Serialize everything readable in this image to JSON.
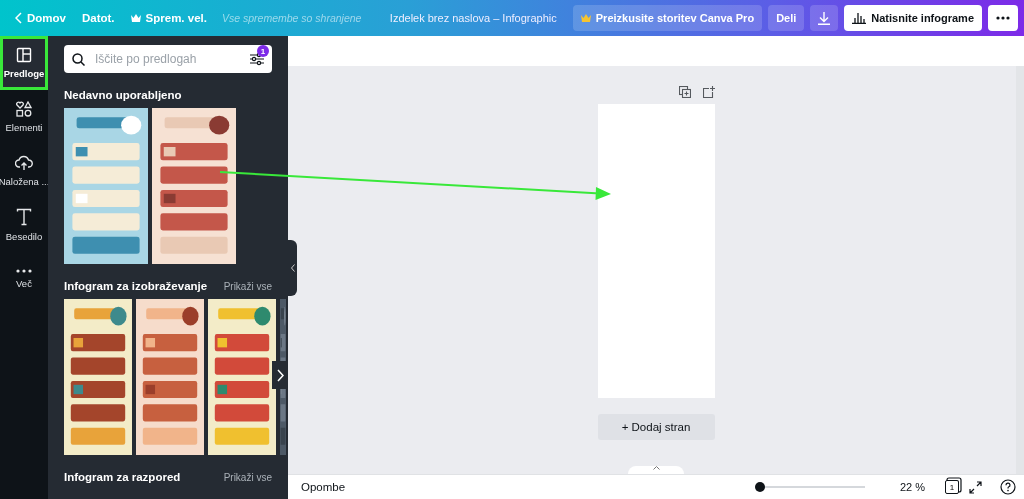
{
  "topbar": {
    "home": "Domov",
    "file": "Datot.",
    "resize": "Sprem. vel.",
    "save_status": "Vse spremembe so shranjene",
    "title": "Izdelek brez naslova – Infographic",
    "buttons": [
      {
        "kind": "pro",
        "label": "Preizkusite storitev Canva Pro"
      },
      {
        "kind": "share",
        "label": "Deli"
      },
      {
        "kind": "download"
      },
      {
        "kind": "print",
        "label": "Natisnite infograme"
      },
      {
        "kind": "more"
      }
    ]
  },
  "sidebar": {
    "items": [
      {
        "kind": "templates",
        "label": "Predloge",
        "selected": true,
        "highlighted": true
      },
      {
        "kind": "elements",
        "label": "Elementi",
        "selected": false,
        "highlighted": false
      },
      {
        "kind": "uploads",
        "label": "Naložena ...",
        "selected": false,
        "highlighted": false
      },
      {
        "kind": "text",
        "label": "Besedilo",
        "selected": false,
        "highlighted": false
      },
      {
        "kind": "more",
        "label": "Več",
        "selected": false,
        "highlighted": false
      }
    ]
  },
  "panel": {
    "search": {
      "placeholder": "Iščite po predlogah",
      "filter_badge": "1"
    },
    "sections": [
      {
        "title": "Nedavno uporabljeno"
      },
      {
        "title": "Infogram za izobraževanje",
        "show_all": "Prikaži vse",
        "has_next": true
      },
      {
        "title": "Infogram za razpored",
        "show_all": "Prikaži vse"
      }
    ]
  },
  "pointer_arrow": true,
  "canvas": {
    "add_page": "+ Dodaj stran"
  },
  "bottom_bar": {
    "notes": "Opombe",
    "zoom": {
      "level": 0,
      "reading": "22 %"
    },
    "page_count": "1"
  }
}
